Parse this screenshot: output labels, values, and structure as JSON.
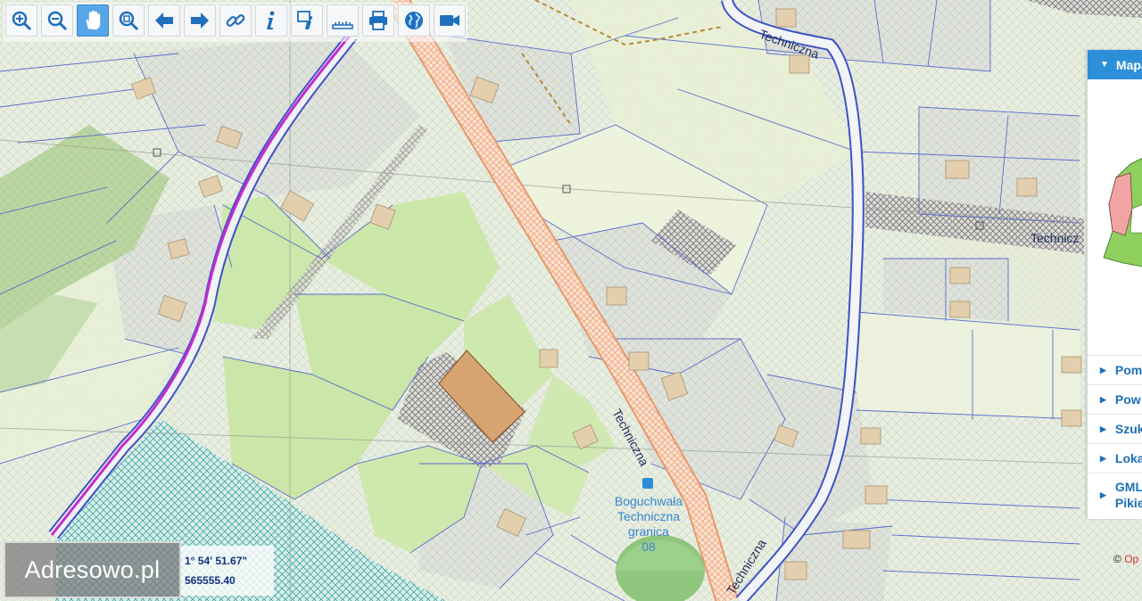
{
  "toolbar": {
    "tools": [
      {
        "name": "zoom-in",
        "icon": "zoom-in-icon"
      },
      {
        "name": "zoom-out",
        "icon": "zoom-out-icon"
      },
      {
        "name": "pan",
        "icon": "hand-icon",
        "active": true
      },
      {
        "name": "zoom-box",
        "icon": "zoom-box-icon"
      },
      {
        "name": "back",
        "icon": "arrow-left-icon"
      },
      {
        "name": "forward",
        "icon": "arrow-right-icon"
      },
      {
        "name": "link",
        "icon": "link-icon"
      },
      {
        "name": "info",
        "icon": "info-icon"
      },
      {
        "name": "info-edit",
        "icon": "info-edit-icon"
      },
      {
        "name": "measure",
        "icon": "ruler-icon"
      },
      {
        "name": "print",
        "icon": "printer-icon"
      },
      {
        "name": "globe",
        "icon": "globe-icon"
      },
      {
        "name": "video",
        "icon": "video-camera-icon"
      }
    ],
    "accent": "#2c8fd8"
  },
  "map": {
    "street_labels": [
      "Techniczna",
      "Techniczna",
      "Technicz",
      "Techniczna"
    ],
    "bus_stop": {
      "line1": "Boguchwała",
      "line2": "Techniczna",
      "line3": "granica",
      "line4": "08"
    },
    "colors": {
      "base": "#e9efe0",
      "parcel_line": "#4a5cc9",
      "road_orange": "#f2b28a",
      "boundary": "#c227c9",
      "parcel_highlight": "#d9a070",
      "field_green": "#c9e6a8"
    }
  },
  "panel": {
    "header": "Mapa",
    "items": [
      {
        "label": "Pom"
      },
      {
        "label": "Pow"
      },
      {
        "label": "Szuk"
      },
      {
        "label": "Loka"
      },
      {
        "label_line1": "GML",
        "label_line2": "Pikie"
      }
    ]
  },
  "logo": "Adresowo.pl",
  "coordinates": {
    "line1": "1° 54' 51.67\"",
    "line2": "565555.40"
  },
  "attribution": {
    "symbol": "©",
    "text": "Op"
  }
}
